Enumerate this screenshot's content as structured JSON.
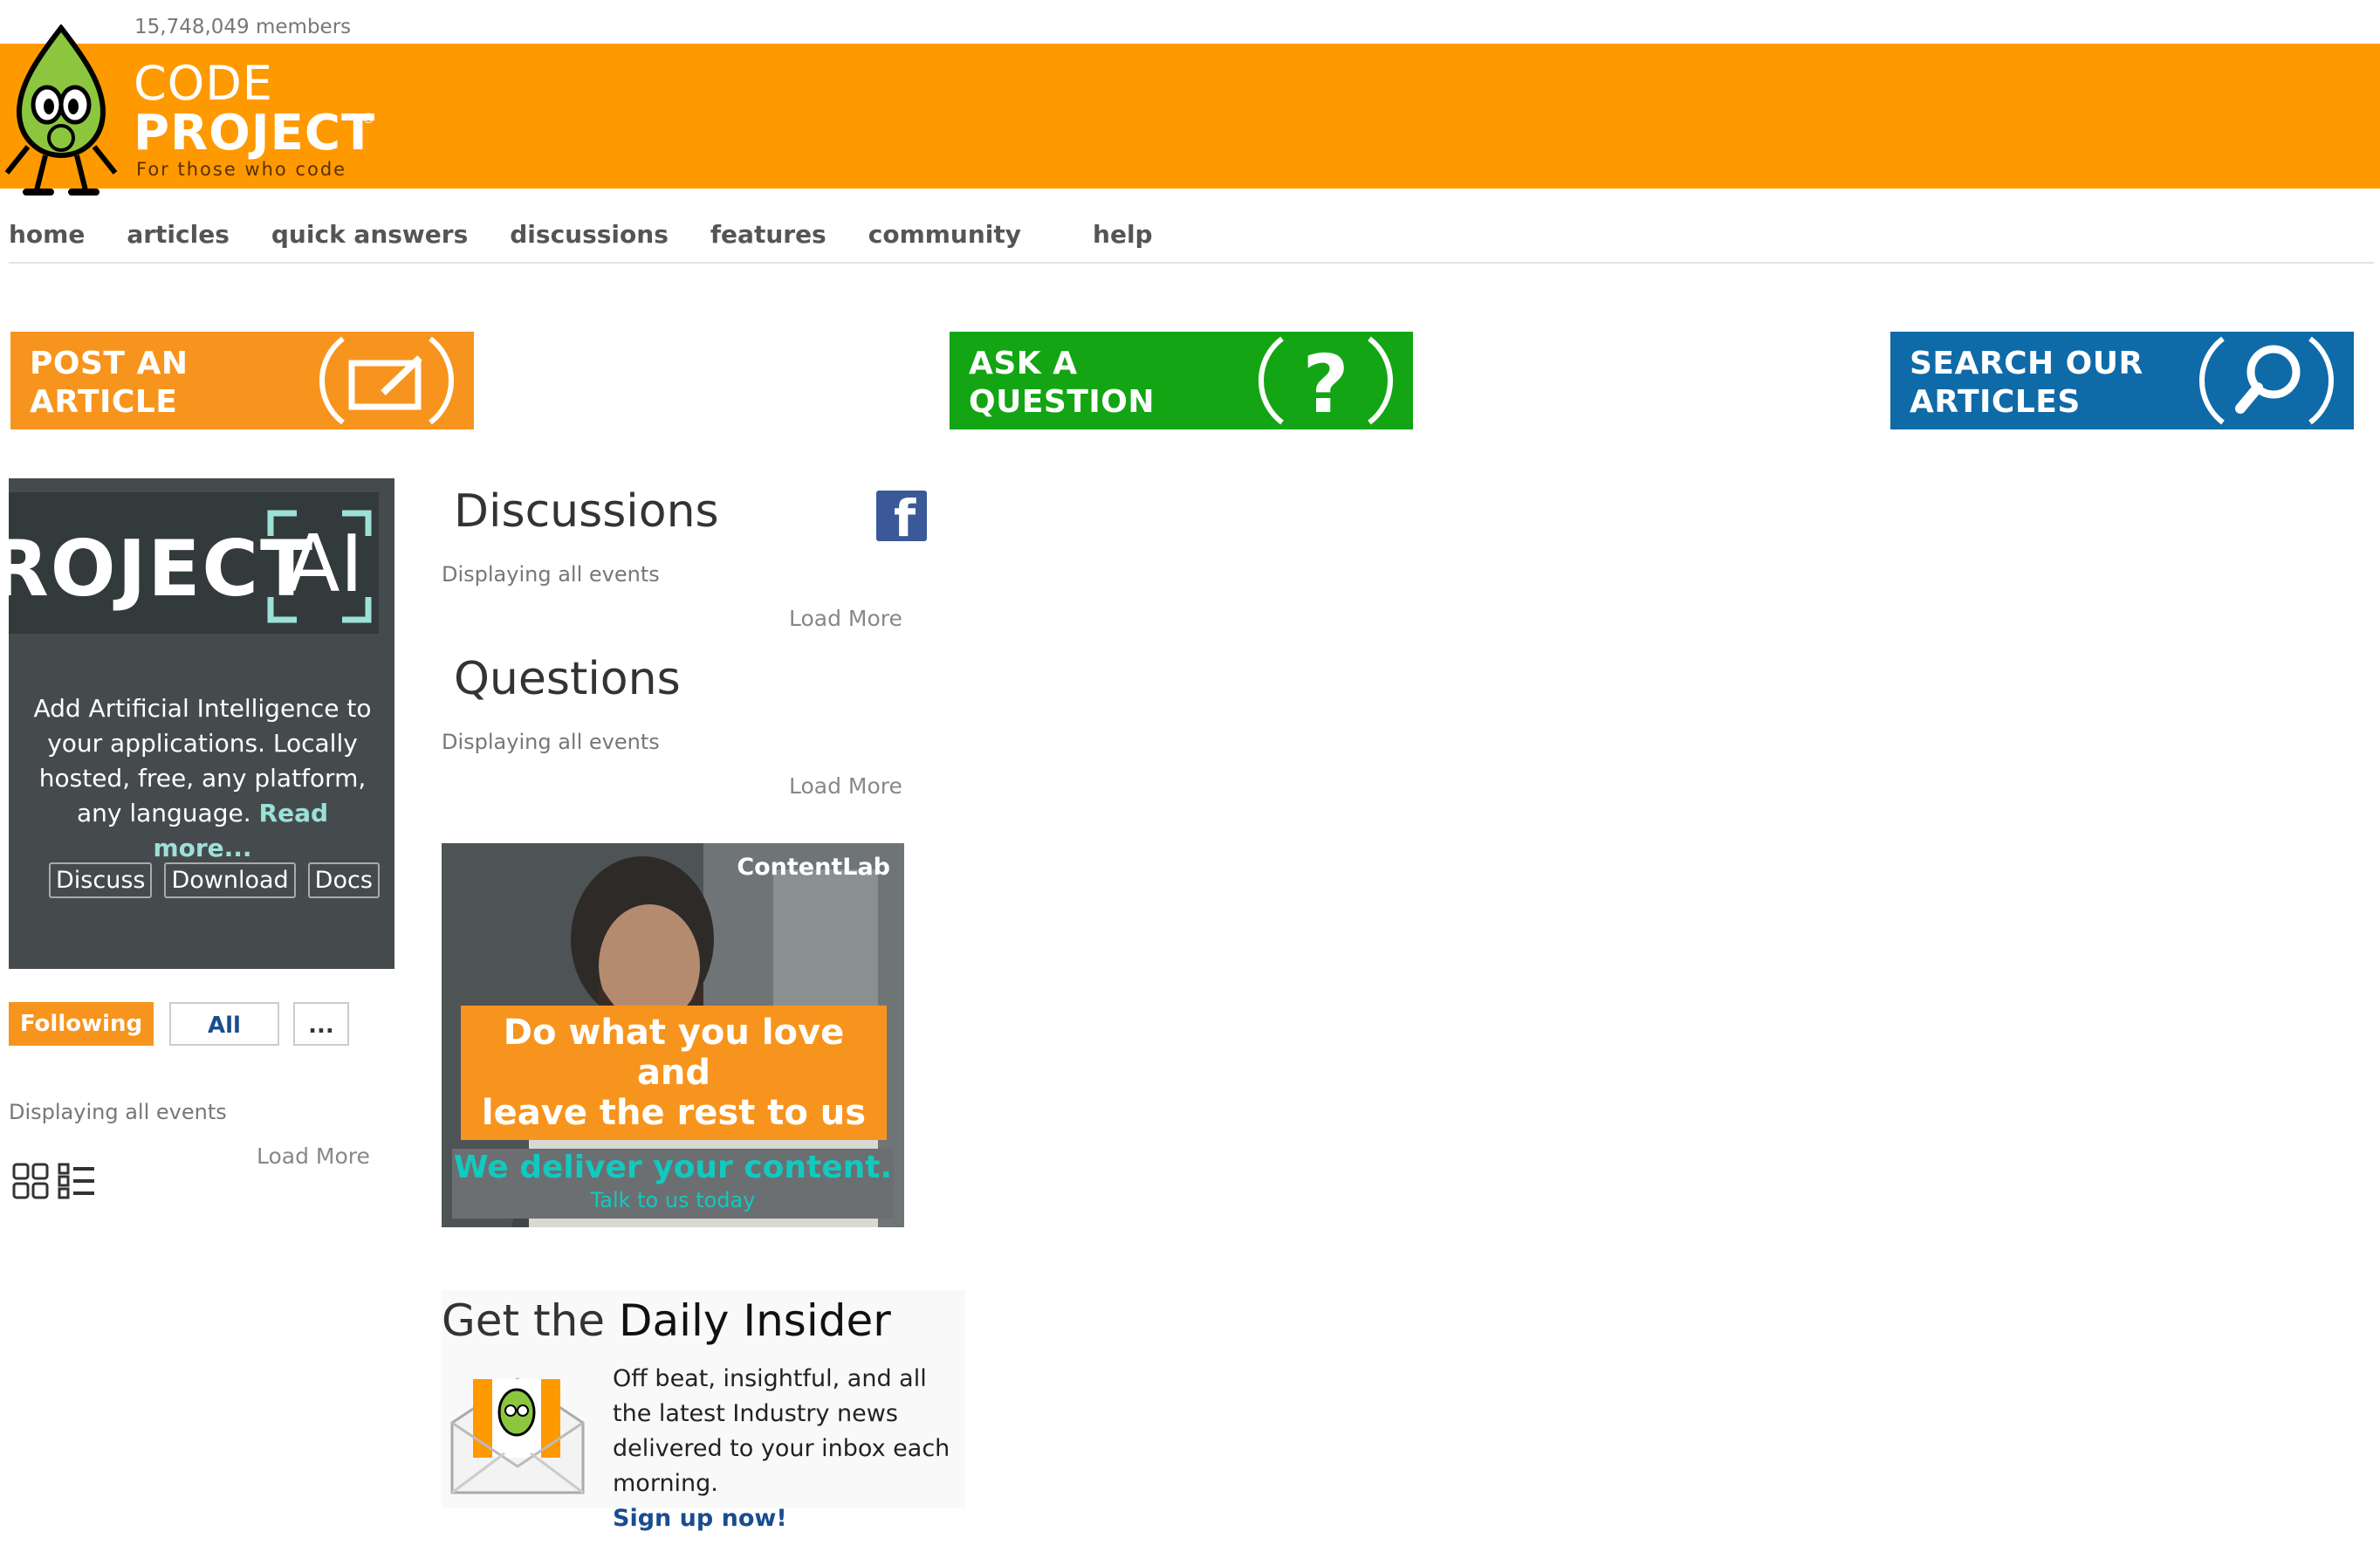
{
  "header": {
    "members": "15,748,049 members",
    "logo_code": "CODE",
    "logo_project": "PROJECT",
    "logo_reg": "®",
    "logo_tagline": "For those who code"
  },
  "nav": [
    "home",
    "articles",
    "quick answers",
    "discussions",
    "features",
    "community",
    "help"
  ],
  "tiles": {
    "post": [
      "POST AN",
      "ARTICLE"
    ],
    "ask": [
      "ASK A",
      "QUESTION"
    ],
    "search": [
      "SEARCH OUR",
      "ARTICLES"
    ]
  },
  "ai_promo": {
    "logo_word": "ROJECT",
    "logo_ai": "AI",
    "text": "Add Artificial Intelligence to your applications. Locally hosted, free, any platform, any language.",
    "read_more": "Read more...",
    "buttons": [
      "Discuss",
      "Download",
      "Docs"
    ]
  },
  "tabs": {
    "following": "Following",
    "all": "All",
    "more": "..."
  },
  "left_feed": {
    "status": "Displaying all events",
    "load_more": "Load More"
  },
  "discussions": {
    "title": "Discussions",
    "status": "Displaying all events",
    "load_more": "Load More"
  },
  "questions": {
    "title": "Questions",
    "status": "Displaying all events",
    "load_more": "Load More"
  },
  "ad": {
    "brand": "ContentLab",
    "headline": [
      "Do what you love and",
      "leave the rest to us"
    ],
    "line1": "We deliver your content.",
    "line2": "Talk to us today"
  },
  "daily_insider": {
    "title_prefix": "Get the",
    "title_main": "Daily Insider",
    "text": "Off beat, insightful, and all the latest Industry news delivered to your inbox each morning.",
    "signup": "Sign up now!"
  },
  "colors": {
    "orange": "#FF9900",
    "green": "#13A513",
    "blue": "#0F6AA8",
    "ai_bg": "#454B4D"
  }
}
